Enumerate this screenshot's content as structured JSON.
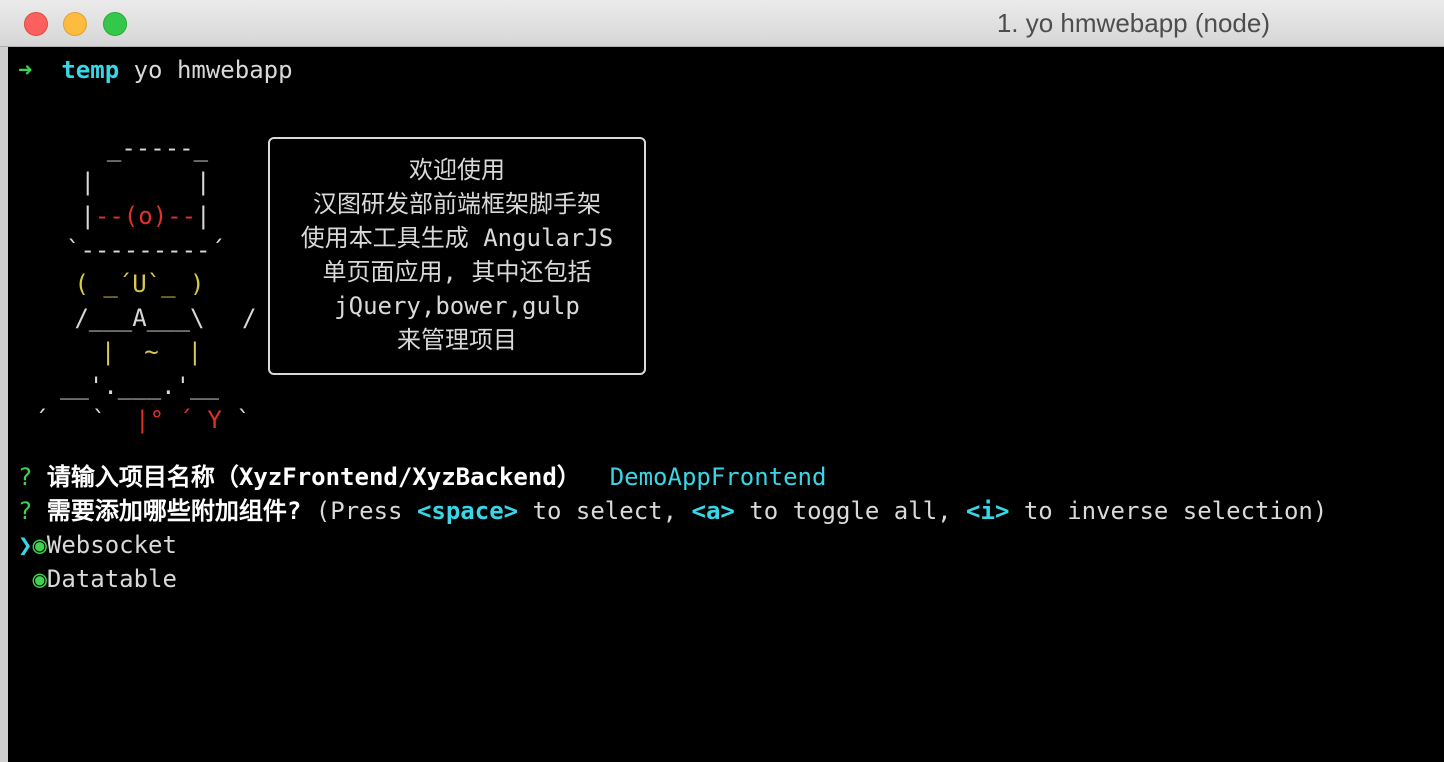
{
  "window": {
    "title": "1. yo hmwebapp (node)"
  },
  "prompt_line": {
    "arrow": "➜",
    "dir": "temp",
    "command": " yo hmwebapp"
  },
  "ascii_art": {
    "l1": "  _-----_",
    "l2a": " |",
    "l2b": "       |",
    "l3a": " |",
    "l3red": "--(o)--",
    "l3b": "|",
    "l4": "`---------´",
    "l5": " ( _´U`_ )",
    "l6": " /___A___\\",
    "l6b": "/",
    "l7": "  |  ~  |",
    "l8": "__'.___.'__",
    "l9a": "´   `  ",
    "l9b": "|° ´ Y",
    "l9c": " `"
  },
  "welcome_box": {
    "lines": [
      "欢迎使用",
      "汉图研发部前端框架脚手架",
      "使用本工具生成 AngularJS",
      "单页面应用, 其中还包括",
      "jQuery,bower,gulp",
      "来管理项目"
    ]
  },
  "question1": {
    "mark": "?",
    "text": " 请输入项目名称（XyzFrontend/XyzBackend）",
    "answer": "DemoAppFrontend"
  },
  "question2": {
    "mark": "?",
    "text": " 需要添加哪些附加组件?",
    "hint_a": " (Press ",
    "key_space": "<space>",
    "hint_b": " to select, ",
    "key_a": "<a>",
    "hint_c": " to toggle all, ",
    "key_i": "<i>",
    "hint_d": " to inverse selection)"
  },
  "choices": [
    {
      "pointer": "❯",
      "radio": "◉",
      "label": "Websocket"
    },
    {
      "pointer": " ",
      "radio": "◉",
      "label": "Datatable"
    }
  ]
}
